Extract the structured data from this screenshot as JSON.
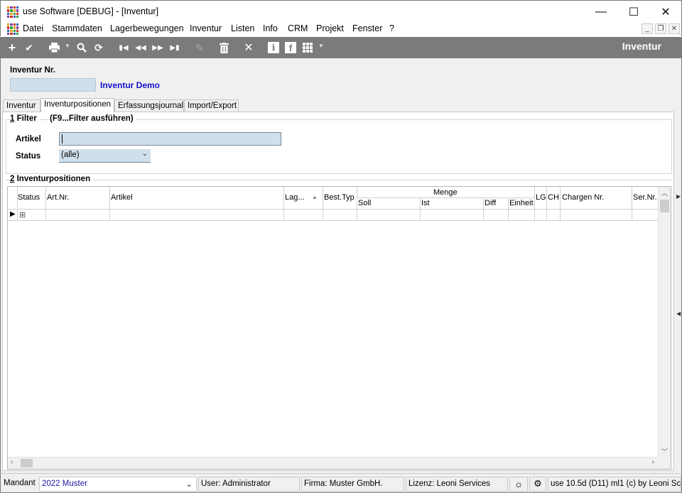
{
  "window": {
    "title": "use Software [DEBUG] - [Inventur]",
    "minimize": "—",
    "maximize": "☐",
    "close": "✕"
  },
  "menu": [
    "Datei",
    "Stammdaten",
    "Lagerbewegungen",
    "Inventur",
    "Listen",
    "Info",
    "CRM",
    "Projekt",
    "Fenster",
    "?"
  ],
  "toolbar": {
    "title": "Inventur",
    "icons": [
      "add-icon",
      "check-icon",
      "print-icon",
      "search-icon",
      "refresh-icon",
      "first-icon",
      "prev-icon",
      "next-icon",
      "last-icon",
      "edit-icon",
      "delete-icon",
      "cancel-icon",
      "info-icon",
      "facebook-icon",
      "grid-icon"
    ]
  },
  "header": {
    "inventur_nr_label": "Inventur Nr.",
    "inventur_name": "Inventur Demo"
  },
  "tabs": [
    "Inventur",
    "Inventurpositionen",
    "Erfassungsjournal",
    "Import/Export"
  ],
  "filter": {
    "group_num": "1",
    "group_title": " Filter",
    "hint": "(F9...Filter ausführen)",
    "artikel_label": "Artikel",
    "artikel_value": "",
    "status_label": "Status",
    "status_value": "(alle)"
  },
  "positions": {
    "group_num": "2",
    "group_title": " Inventurpositionen",
    "menge_header": "Menge",
    "columns": [
      "Status",
      "Art.Nr.",
      "Artikel",
      "Lag...",
      "Best.Typ",
      "Soll",
      "Ist",
      "Diff",
      "Einheit",
      "LG",
      "CH",
      "Chargen Nr.",
      "Ser.Nr."
    ],
    "sort_indicator": "▲",
    "expand_symbol": "⊞"
  },
  "statusbar": {
    "mandant_label": "Mandant",
    "mandant_value": "2022 Muster",
    "user": "User: Administrator",
    "firma": "Firma: Muster GmbH.",
    "lizenz": "Lizenz: Leoni Services",
    "version": "use 10.5d (D11) ml1 (c) by Leoni Sc"
  }
}
